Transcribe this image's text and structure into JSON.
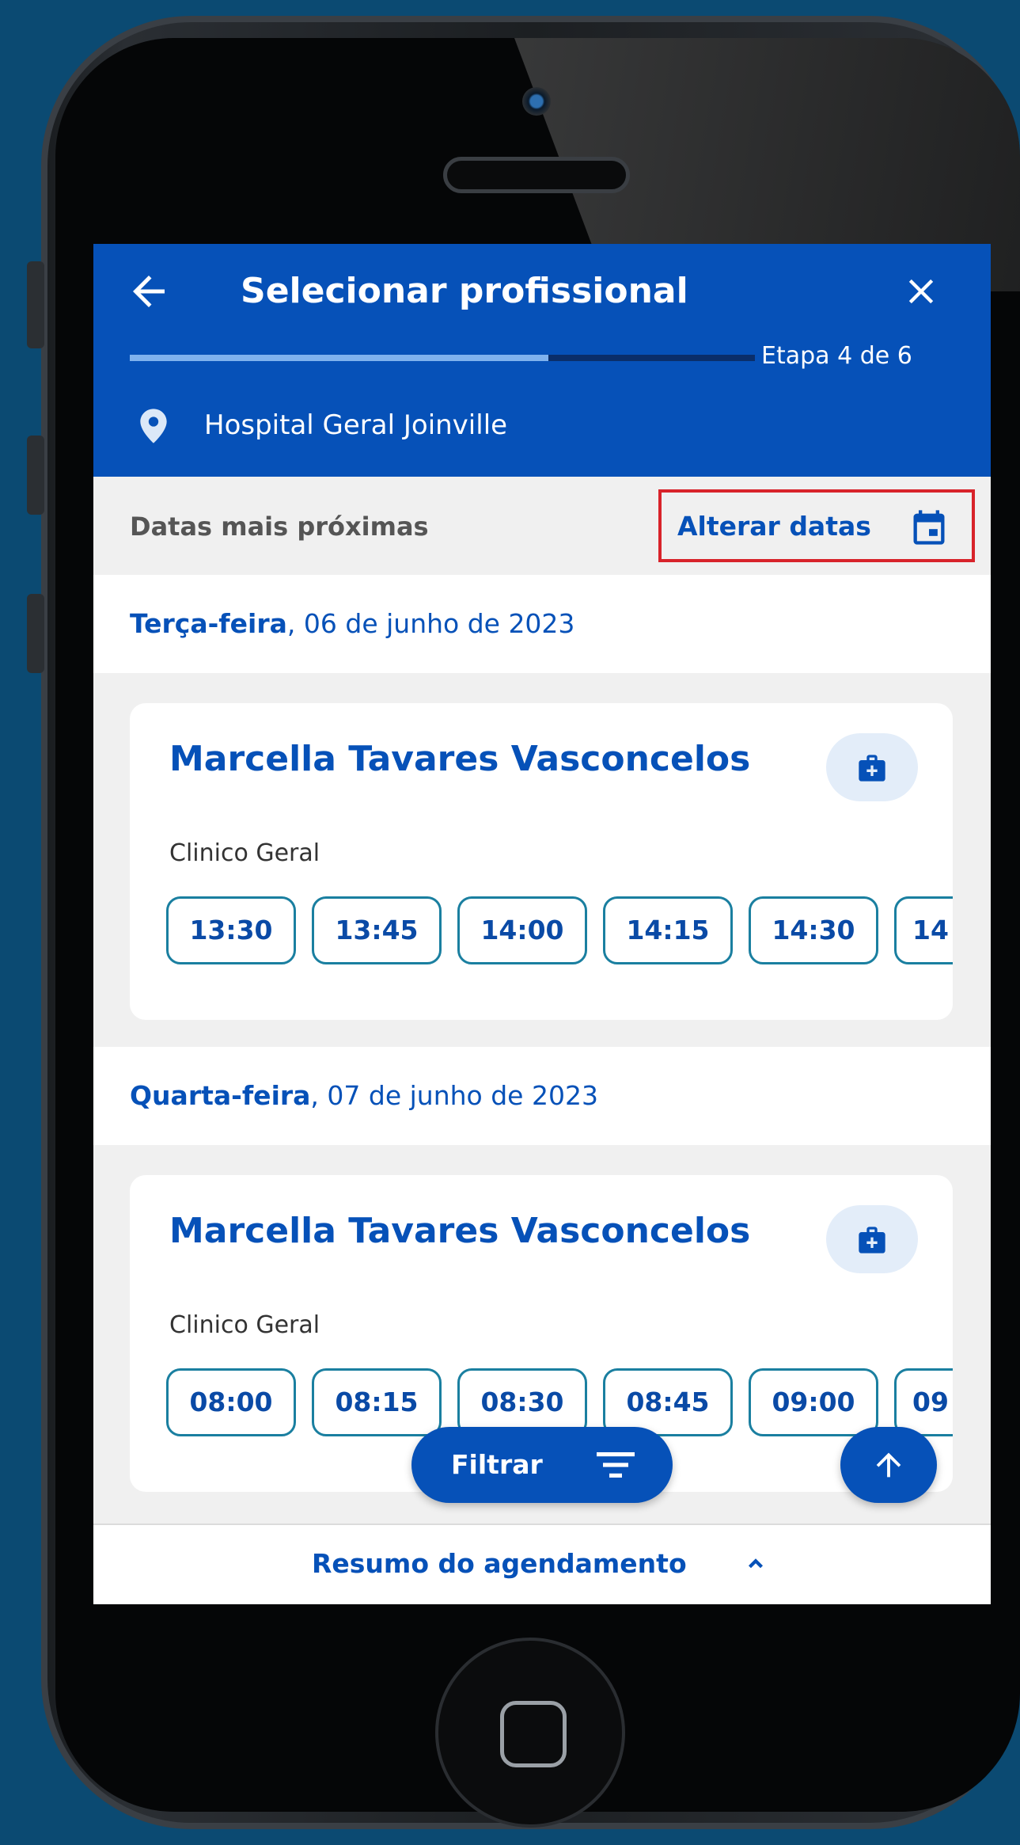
{
  "header": {
    "title": "Selecionar profissional",
    "step": "Etapa 4 de 6",
    "progress": 0.67,
    "location": "Hospital Geral Joinville"
  },
  "subbar": {
    "label": "Datas mais próximas",
    "alter_label": "Alterar datas"
  },
  "days": [
    {
      "weekday": "Terça-feira",
      "date": ", 06 de junho de 2023",
      "doctor": "Marcella Tavares Vasconcelos",
      "specialty": "Clinico Geral",
      "slots": [
        "13:30",
        "13:45",
        "14:00",
        "14:15",
        "14:30",
        "14"
      ]
    },
    {
      "weekday": "Quarta-feira",
      "date": ", 07 de junho de 2023",
      "doctor": "Marcella Tavares Vasconcelos",
      "specialty": "Clinico Geral",
      "slots": [
        "08:00",
        "08:15",
        "08:30",
        "08:45",
        "09:00",
        "09"
      ]
    }
  ],
  "filter_label": "Filtrar",
  "summary_label": "Resumo do agendamento",
  "colors": {
    "primary": "#0651b8",
    "highlight": "#d8232a",
    "slot_border": "#1a7fa0"
  },
  "icons": [
    "back-arrow-icon",
    "close-icon",
    "location-pin-icon",
    "calendar-icon",
    "medical-bag-icon",
    "filter-icon",
    "arrow-up-icon",
    "chevron-up-icon"
  ]
}
